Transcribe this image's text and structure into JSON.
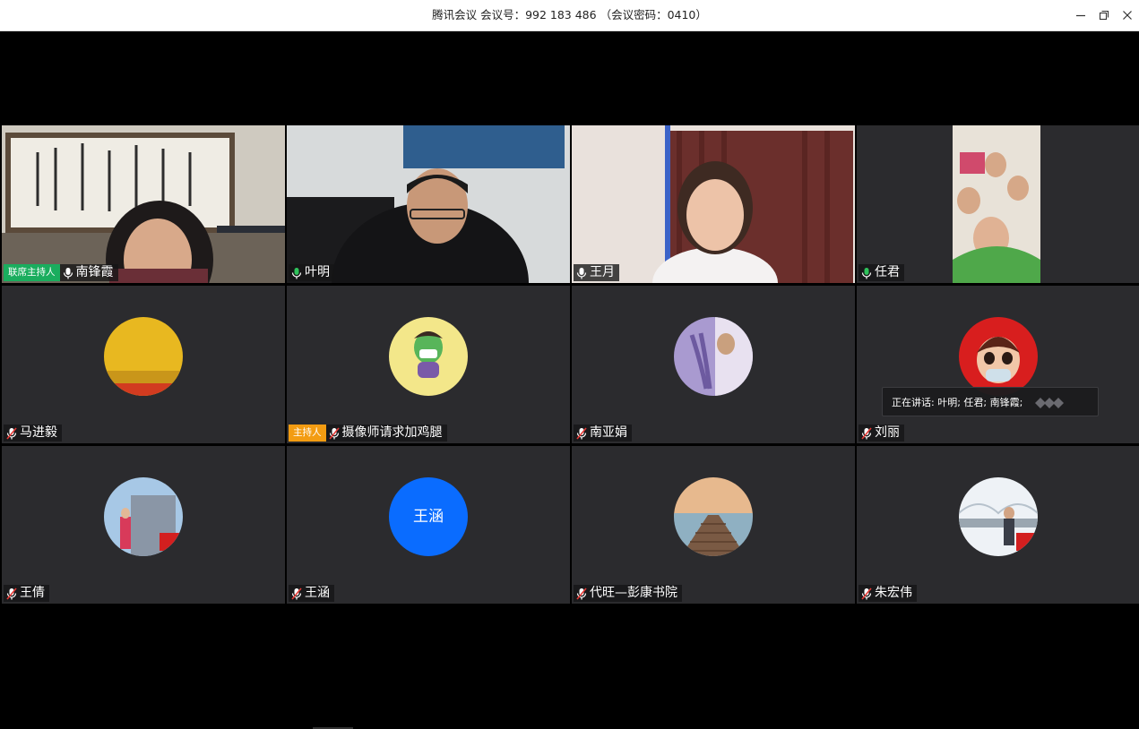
{
  "window": {
    "title": "腾讯会议 会议号：992 183 486 （会议密码：0410）"
  },
  "participants": [
    {
      "name": "南锋霞",
      "role": "联席主持人",
      "mic": "on",
      "video": true
    },
    {
      "name": "叶明",
      "role": "",
      "mic": "on",
      "video": true
    },
    {
      "name": "王月",
      "role": "",
      "mic": "on",
      "video": true
    },
    {
      "name": "任君",
      "role": "",
      "mic": "on",
      "video": true
    },
    {
      "name": "马进毅",
      "role": "",
      "mic": "muted",
      "video": false,
      "avatar": "yellow-field-avatar"
    },
    {
      "name": "摄像师请求加鸡腿",
      "role": "主持人",
      "mic": "muted",
      "video": false,
      "avatar": "cartoon-avatar"
    },
    {
      "name": "南亚娟",
      "role": "",
      "mic": "muted",
      "video": false,
      "avatar": "lavender-avatar"
    },
    {
      "name": "刘丽",
      "role": "",
      "mic": "muted",
      "video": false,
      "avatar": "doll-avatar"
    },
    {
      "name": "王倩",
      "role": "",
      "mic": "muted",
      "video": false,
      "avatar": "building-avatar"
    },
    {
      "name": "王涵",
      "role": "",
      "mic": "muted",
      "video": false,
      "avatar_text": "王涵"
    },
    {
      "name": "代旺—彭康书院",
      "role": "",
      "mic": "muted",
      "video": false,
      "avatar": "pier-avatar"
    },
    {
      "name": "朱宏伟",
      "role": "",
      "mic": "muted",
      "video": false,
      "avatar": "bridge-avatar"
    }
  ],
  "speaking": {
    "label": "正在讲话:",
    "names": "叶明; 任君; 南锋霞;"
  },
  "colors": {
    "cohost_badge": "#1aad5e",
    "host_badge": "#f39c12",
    "mic_on": "#2fc25b",
    "mic_muted": "#e53935",
    "tile_bg": "#2b2b2e",
    "text_avatar": "#0a6cff"
  }
}
